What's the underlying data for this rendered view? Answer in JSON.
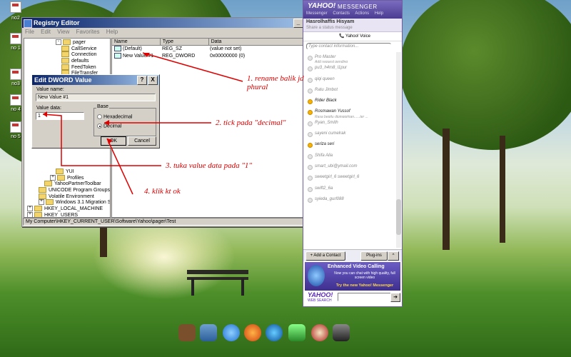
{
  "desktop": {
    "icons": [
      "no2",
      "no 1",
      "no3",
      "no 4",
      "no 5"
    ]
  },
  "regedit": {
    "title": "Registry Editor",
    "menu": [
      "File",
      "Edit",
      "View",
      "Favorites",
      "Help"
    ],
    "tree": [
      {
        "label": "pager",
        "indent": 5,
        "expander": "-"
      },
      {
        "label": "CallService",
        "indent": 6
      },
      {
        "label": "Connection",
        "indent": 6
      },
      {
        "label": "defaults",
        "indent": 6
      },
      {
        "label": "FeedToken",
        "indent": 6
      },
      {
        "label": "FileTransfer",
        "indent": 6
      }
    ],
    "tree_lower": [
      {
        "label": "YUI",
        "indent": 5
      },
      {
        "label": "Profiles",
        "indent": 4,
        "expander": "+"
      },
      {
        "label": "YahooPartnerToolbar",
        "indent": 3
      },
      {
        "label": "UNICODE Program Groups",
        "indent": 2
      },
      {
        "label": "Volatile Environment",
        "indent": 2
      },
      {
        "label": "Windows 3.1 Migration Status",
        "indent": 2,
        "expander": "+"
      },
      {
        "label": "HKEY_LOCAL_MACHINE",
        "indent": 0,
        "expander": "+"
      },
      {
        "label": "HKEY_USERS",
        "indent": 0,
        "expander": "+"
      },
      {
        "label": "HKEY_CURRENT_CONFIG",
        "indent": 0,
        "expander": "+"
      }
    ],
    "columns": [
      "Name",
      "Type",
      "Data"
    ],
    "values": [
      {
        "name": "(Default)",
        "type": "REG_SZ",
        "data": "(value not set)"
      },
      {
        "name": "New Value #1",
        "type": "REG_DWORD",
        "data": "0x00000000 (0)"
      }
    ],
    "status": "My Computer\\HKEY_CURRENT_USER\\Software\\Yahoo\\pager\\Test"
  },
  "dialog": {
    "title": "Edit DWORD Value",
    "value_name_label": "Value name:",
    "value_name": "New Value #1",
    "value_data_label": "Value data:",
    "value_data": "1",
    "base_label": "Base",
    "hex_label": "Hexadecimal",
    "dec_label": "Decimal",
    "ok": "OK",
    "cancel": "Cancel",
    "close": "X"
  },
  "messenger": {
    "logo": "YAHOO!",
    "title": "MESSENGER",
    "menu": [
      "Messenger",
      "Contacts",
      "Actions",
      "Help"
    ],
    "user": "Hasrolhaffis Hisyam",
    "status_placeholder": "Share a status message",
    "voice": "Yahoo! Voice",
    "search_placeholder": "Type contact information...",
    "contacts": [
      {
        "name": "Pro Master",
        "sub": "Add request pending",
        "online": false
      },
      {
        "name": "pu3_h4m8_l1pur",
        "online": false
      },
      {
        "name": "qiqi queen",
        "online": false
      },
      {
        "name": "Ratu Jimbot",
        "online": false
      },
      {
        "name": "Rider Black",
        "online": true
      },
      {
        "name": "Rosmawan Yussof",
        "sub": "Rasa begitu dipinggirkan......ter ...",
        "online": true
      },
      {
        "name": "Ryan_Smith",
        "online": false
      },
      {
        "name": "sayeni cumelrak",
        "online": false
      },
      {
        "name": "seriza seri",
        "online": true
      },
      {
        "name": "Shifa Alia",
        "online": false
      },
      {
        "name": "smart_ubi@ymail.com",
        "online": false
      },
      {
        "name": "sweetgirl_6 sweetgirl_6",
        "online": false
      },
      {
        "name": "swift2_6a",
        "online": false
      },
      {
        "name": "syieda_gurl088",
        "online": false
      }
    ],
    "add_contact": "Add a Contact",
    "plugins": "Plug-ins",
    "ad_title": "Enhanced Video Calling",
    "ad_text": "Now you can chat with high quality, full screen video",
    "ad_cta": "Try the new Yahoo! Messenger",
    "search_logo": "YAHOO!",
    "search_sub": "WEB SEARCH"
  },
  "annotations": {
    "a1": "1. rename balik jd phural",
    "a2": "2. tick pada \"decimal\"",
    "a3": "3. tuka value data pada \"1\"",
    "a4": "4. klik kt ok"
  },
  "colors": {
    "annotation": "#e00000",
    "titlebar": "#0a246a",
    "messenger_purple": "#4b3b91"
  }
}
